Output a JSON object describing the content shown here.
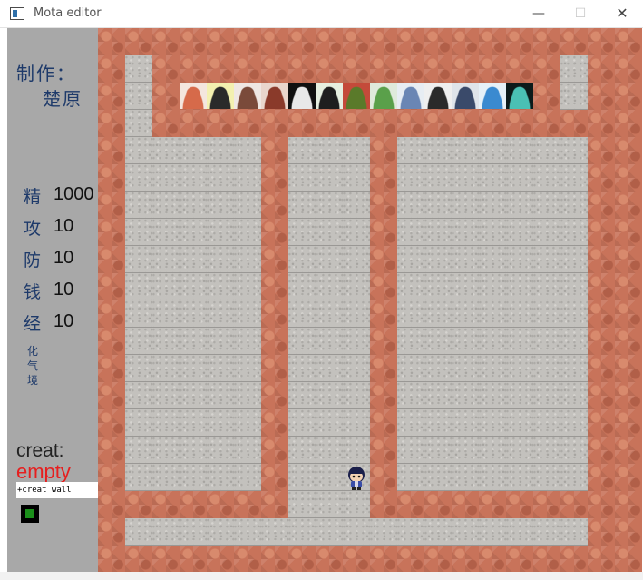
{
  "window": {
    "title": "Mota editor",
    "minimize_glyph": "—",
    "maximize_glyph": "☐",
    "close_glyph": "✕"
  },
  "sidebar": {
    "credit_label": "制作：",
    "credit_name": "楚原",
    "stats": [
      {
        "label": "精",
        "value": "1000"
      },
      {
        "label": "攻",
        "value": "10"
      },
      {
        "label": "防",
        "value": "10"
      },
      {
        "label": "钱",
        "value": "10"
      },
      {
        "label": "经",
        "value": "10"
      }
    ],
    "realm": "化气境",
    "creat_label": "creat:",
    "creat_value": "empty",
    "command_value": "+creat wall"
  },
  "map": {
    "cols": 20,
    "rows": 20,
    "grid": [
      "WWWWWWWWWWWWWWWWWWWW",
      "WFWWWWWWWWWWWWWWWFWW",
      "WFWWWWWWWWWWWWWWWFWW",
      "WFWWWWWWWWWWWWWWWWWW",
      "WFFFFFWFFFWFFFFFFFWW",
      "WFFFFFWFFFWFFFFFFFWW",
      "WFFFFFWFFFWFFFFFFFWW",
      "WFFFFFWFFFWFFFFFFFWW",
      "WFFFFFWFFFWFFFFFFFWW",
      "WFFFFFWFFFWFFFFFFFWW",
      "WFFFFFWFFFWFFFFFFFWW",
      "WFFFFFWFFFWFFFFFFFWW",
      "WFFFFFWFFFWFFFFFFFWW",
      "WFFFFFWFFFWFFFFFFFWW",
      "WFFFFFWFFFWFFFFFFFWW",
      "WFFFFFWFFFWFFFFFFFWW",
      "WFFFFFWFFFWFFFFFFFWW",
      "WWWWWWWFFFWWWWWWWWWW",
      "WFFFFFFFFFFFFFFFFFWW",
      "WWWWWWWWWWWWWWWWWWWW"
    ],
    "hero": "hero-sprite",
    "avatars": [
      {
        "name": "avatar-1",
        "bg": "#f4e6de",
        "fg": "#d66a4a"
      },
      {
        "name": "avatar-2",
        "bg": "#f3f0b0",
        "fg": "#2a2a2a"
      },
      {
        "name": "avatar-3",
        "bg": "#efe7e3",
        "fg": "#7a4a3a"
      },
      {
        "name": "avatar-4",
        "bg": "#e9d6cc",
        "fg": "#8a3a2a"
      },
      {
        "name": "avatar-5",
        "bg": "#101010",
        "fg": "#e8e8e8"
      },
      {
        "name": "avatar-6",
        "bg": "#e6efe0",
        "fg": "#1e1e1e"
      },
      {
        "name": "avatar-7",
        "bg": "#c44a3a",
        "fg": "#5a7a2a"
      },
      {
        "name": "avatar-8",
        "bg": "#dfeadb",
        "fg": "#5aa04a"
      },
      {
        "name": "avatar-9",
        "bg": "#e7edf3",
        "fg": "#6a86b4"
      },
      {
        "name": "avatar-10",
        "bg": "#efefef",
        "fg": "#2a2a2a"
      },
      {
        "name": "avatar-11",
        "bg": "#dfe4ea",
        "fg": "#3a4a6a"
      },
      {
        "name": "avatar-12",
        "bg": "#e6f1f8",
        "fg": "#3a8ad0"
      },
      {
        "name": "avatar-13",
        "bg": "#0c1a1a",
        "fg": "#4ac0b4"
      }
    ]
  },
  "colors": {
    "sidebar": "#a8a8a8",
    "wall": "#c8735a",
    "floor": "#c3c1bd",
    "creat_value": "#e61f1f",
    "label_blue": "#1e3a6a"
  }
}
